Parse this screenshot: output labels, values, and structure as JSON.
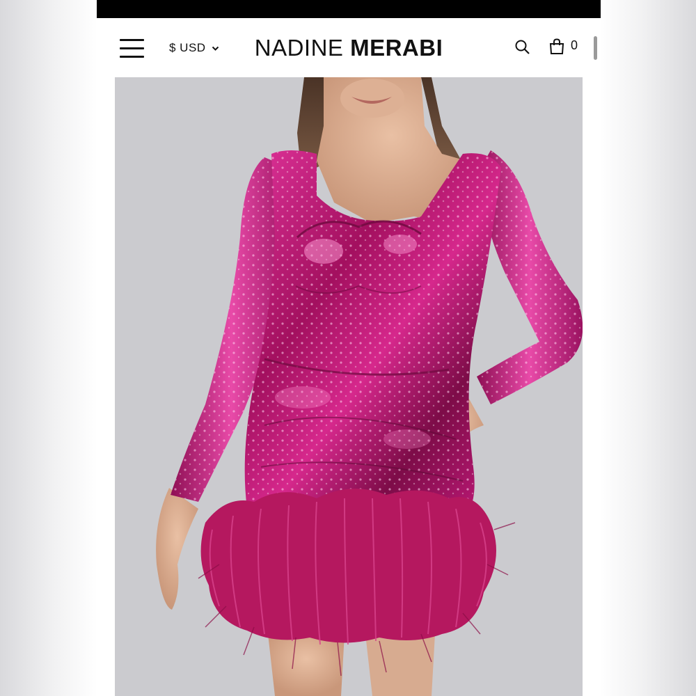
{
  "header": {
    "currency": {
      "label": "$ USD",
      "icon": "chevron-down-icon"
    },
    "logo": {
      "light": "NADINE",
      "bold": "MERABI"
    },
    "cart": {
      "count": "0",
      "icon": "shopping-bag-icon"
    },
    "search": {
      "icon": "search-icon"
    },
    "menu": {
      "icon": "hamburger-menu-icon"
    }
  },
  "product": {
    "image": "model-in-pink-sequin-long-sleeve-mini-dress-with-feather-hem",
    "colors": {
      "dress": "#c4177a",
      "feathers": "#b5185f",
      "background": "#c5c5ca"
    }
  }
}
